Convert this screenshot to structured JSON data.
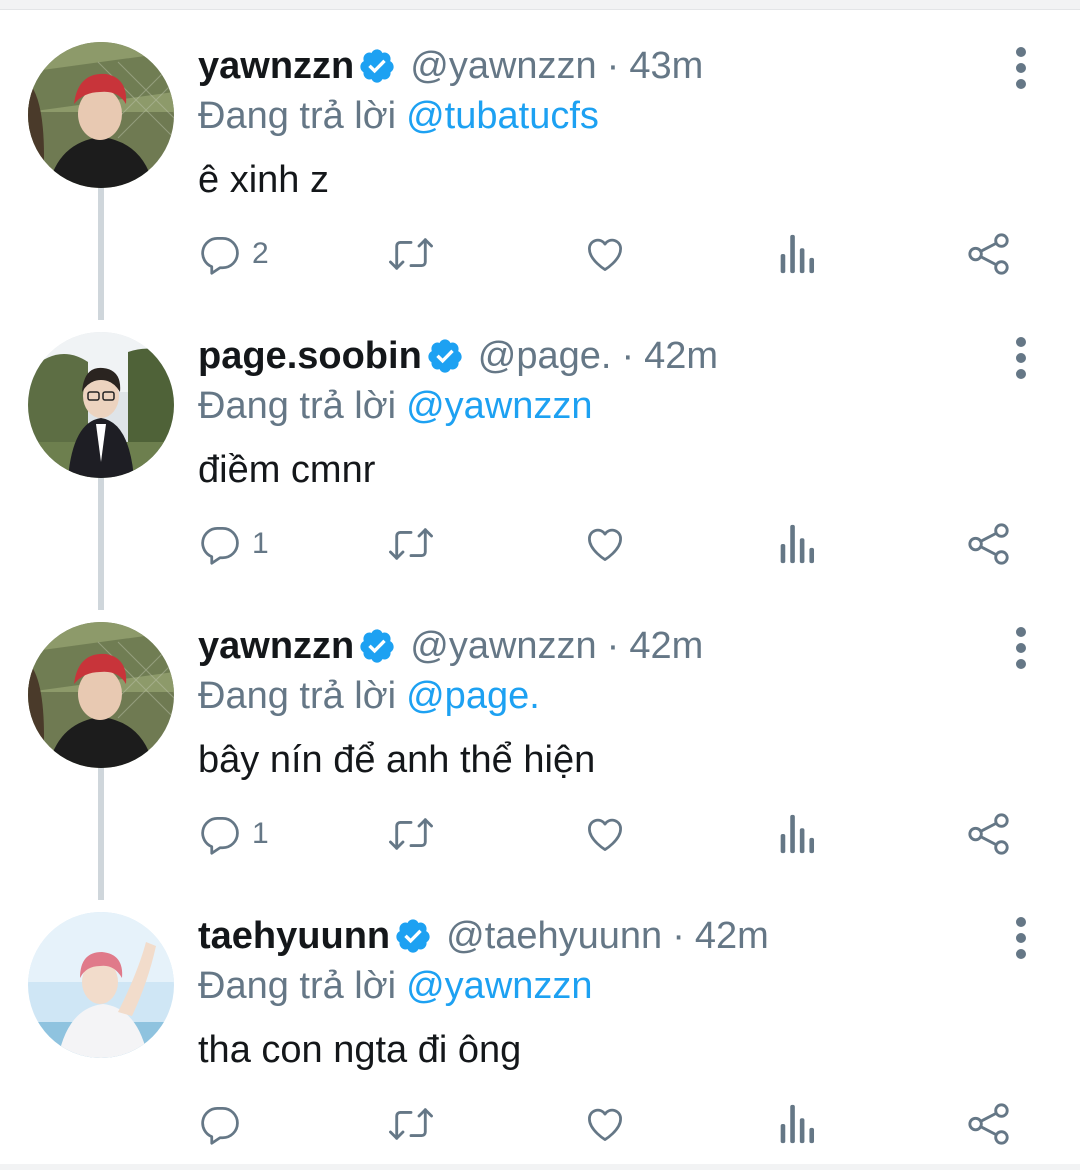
{
  "tweets": [
    {
      "name": "yawnzzn",
      "handle": "@yawnzzn",
      "time": "43m",
      "reply_label": "Đang trả lời",
      "reply_to": "@tubatucfs",
      "text": "ê xinh z",
      "reply_count": "2",
      "avatar": "yawnzzn-avatar"
    },
    {
      "name": "page.soobin",
      "handle": "@page.",
      "time": "42m",
      "reply_label": "Đang trả lời",
      "reply_to": "@yawnzzn",
      "text": "điềm cmnr",
      "reply_count": "1",
      "avatar": "soobin-avatar"
    },
    {
      "name": "yawnzzn",
      "handle": "@yawnzzn",
      "time": "42m",
      "reply_label": "Đang trả lời",
      "reply_to": "@page.",
      "text": "bây nín để anh thể hiện",
      "reply_count": "1",
      "avatar": "yawnzzn-avatar"
    },
    {
      "name": "taehyuunn",
      "handle": "@taehyuunn",
      "time": "42m",
      "reply_label": "Đang trả lời",
      "reply_to": "@yawnzzn",
      "text": "tha con ngta đi ông",
      "reply_count": "",
      "avatar": "taehyuunn-avatar"
    }
  ],
  "separator": "·",
  "icons": {
    "reply": "reply-icon",
    "retweet": "retweet-icon",
    "like": "like-icon",
    "analytics": "analytics-icon",
    "share": "share-icon",
    "more": "more-vertical-icon",
    "verified": "verified-badge-icon"
  },
  "colors": {
    "text": "#14171a",
    "secondary": "#657786",
    "link": "#1da1f2",
    "verified": "#1da1f2",
    "thread_line": "#cfd6db"
  }
}
